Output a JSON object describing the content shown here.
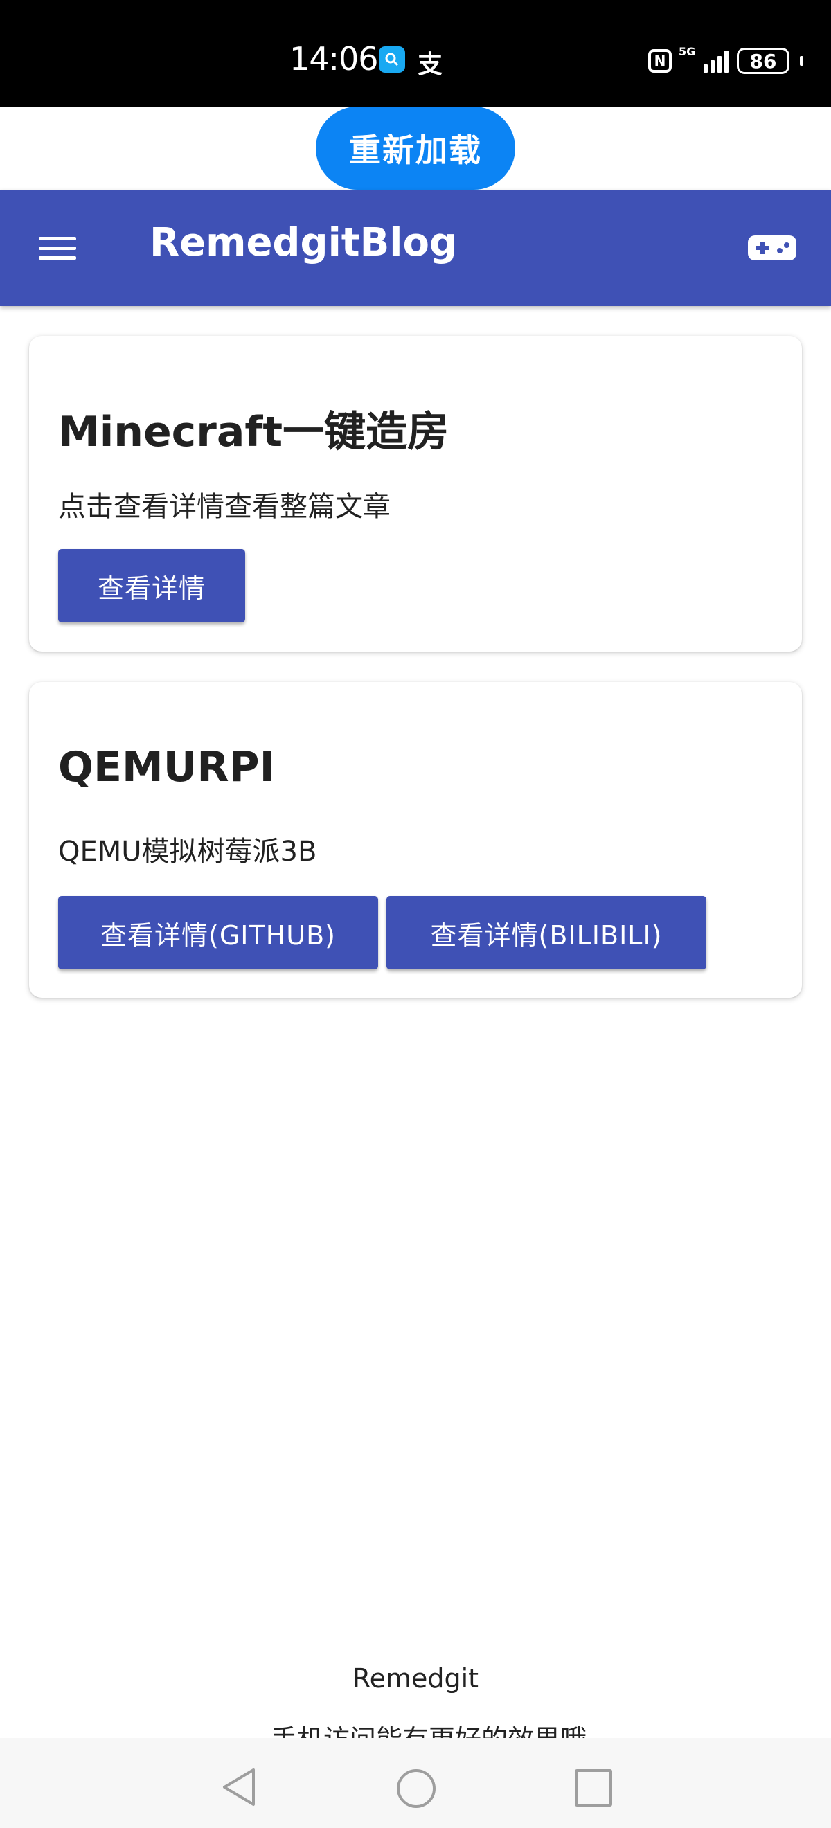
{
  "status_bar": {
    "time": "14:06",
    "app_badge": "支",
    "network": "5G",
    "battery": "86"
  },
  "reload_button": {
    "label": "重新加载"
  },
  "app_bar": {
    "title": "RemedgitBlog",
    "menu_icon": "hamburger-menu-icon",
    "action_icon": "gamepad-icon",
    "color": "#3f51b5"
  },
  "cards": [
    {
      "title": "Minecraft一键造房",
      "description": "点击查看详情查看整篇文章",
      "buttons": [
        "查看详情"
      ]
    },
    {
      "title": "QEMURPI",
      "description": "QEMU模拟树莓派3B",
      "buttons": [
        "查看详情(GITHUB)",
        "查看详情(BILIBILI)"
      ]
    }
  ],
  "footer": {
    "name": "Remedgit",
    "note": "…手机访问能有更好的效果哦"
  }
}
